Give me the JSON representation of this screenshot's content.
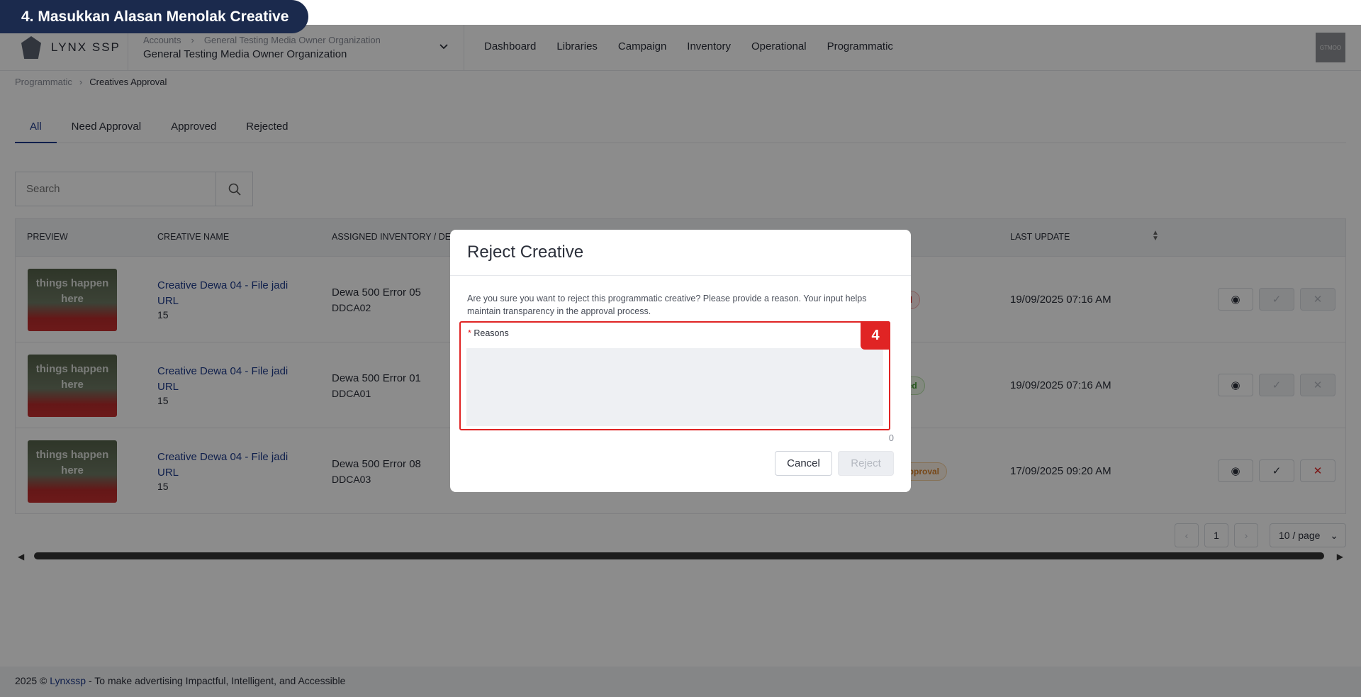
{
  "banner": {
    "step_title": "4. Masukkan Alasan Menolak Creative"
  },
  "header": {
    "logo_text": "LYNX SSP",
    "org_crumb": [
      "Accounts",
      "General Testing Media Owner Organization"
    ],
    "org_name": "General Testing Media Owner Organization",
    "nav": [
      "Dashboard",
      "Libraries",
      "Campaign",
      "Inventory",
      "Operational",
      "Programmatic"
    ],
    "avatar_text": "GTMOO"
  },
  "breadcrumb": {
    "parent": "Programmatic",
    "current": "Creatives Approval"
  },
  "tabs": [
    "All",
    "Need Approval",
    "Approved",
    "Rejected"
  ],
  "search": {
    "placeholder": "Search"
  },
  "table": {
    "columns": [
      "PREVIEW",
      "CREATIVE NAME",
      "ASSIGNED INVENTORY / DE",
      "LAST UPDATE"
    ],
    "rows": [
      {
        "thumb_text": "things happen here",
        "name": "Creative Dewa 04 - File jadi URL",
        "sub": "15",
        "inventory": "Dewa 500 Error 05",
        "code": "DDCA02",
        "status": "ed",
        "updated": "19/09/2025 07:16 AM"
      },
      {
        "thumb_text": "things happen here",
        "name": "Creative Dewa 04 - File jadi URL",
        "sub": "15",
        "inventory": "Dewa 500 Error 01",
        "code": "DDCA01",
        "status": "ved",
        "updated": "19/09/2025 07:16 AM"
      },
      {
        "thumb_text": "things happen here",
        "name": "Creative Dewa 04 - File jadi URL",
        "sub": "15",
        "inventory": "Dewa 500 Error 08",
        "code": "DDCA03",
        "status": "Approval",
        "updated": "17/09/2025 09:20 AM"
      }
    ]
  },
  "pagination": {
    "page": "1",
    "page_size": "10 / page"
  },
  "footer": {
    "prefix": "2025 © ",
    "brand": "Lynxssp",
    "tagline": " - To make advertising Impactful, Intelligent, and Accessible"
  },
  "modal": {
    "title": "Reject Creative",
    "description": "Are you sure you want to reject this programmatic creative? Please provide a reason. Your input helps maintain transparency in the approval process.",
    "field_label": "Reasons",
    "required_mark": "*",
    "char_count": "0",
    "step_number": "4",
    "cancel_label": "Cancel",
    "reject_label": "Reject"
  },
  "colors": {
    "accent": "#1d3a8a",
    "danger": "#e02424",
    "banner": "#1b2a4d"
  }
}
